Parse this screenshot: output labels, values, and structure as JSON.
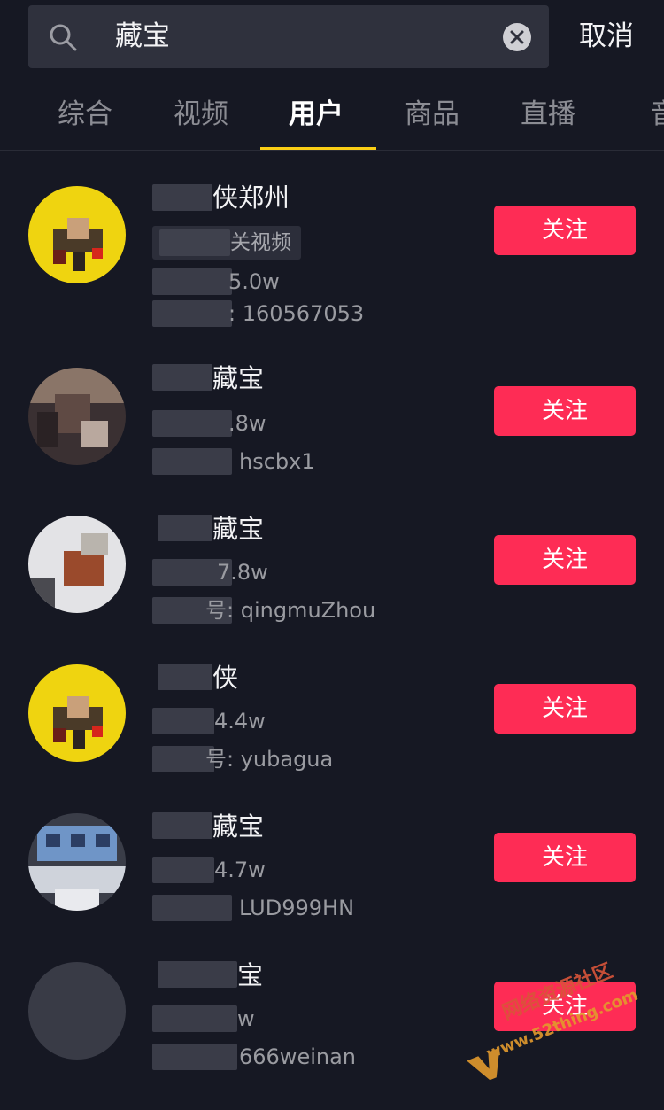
{
  "search": {
    "query": "藏宝",
    "cancel_label": "取消"
  },
  "tabs": [
    {
      "label": "综合"
    },
    {
      "label": "视频"
    },
    {
      "label": "用户",
      "active": true
    },
    {
      "label": "商品"
    },
    {
      "label": "直播"
    },
    {
      "label": "音"
    }
  ],
  "users": [
    {
      "name_suffix": "侠郑州",
      "tag_suffix": "关视频",
      "followers_suffix": "5.0w",
      "id_suffix": ": 160567053",
      "follow_label": "关注",
      "avatar": "yellow-cartoon"
    },
    {
      "name_suffix": "藏宝",
      "followers_suffix": ".8w",
      "id_suffix": "hscbx1",
      "follow_label": "关注",
      "avatar": "photo-dark"
    },
    {
      "name_suffix": "藏宝",
      "followers_suffix": "7.8w",
      "id_suffix": "号: qingmuZhou",
      "follow_label": "关注",
      "avatar": "photo-light"
    },
    {
      "name_suffix": "侠",
      "followers_suffix": "4.4w",
      "id_suffix": "号: yubagua",
      "follow_label": "关注",
      "avatar": "yellow-cartoon"
    },
    {
      "name_suffix": "藏宝",
      "followers_suffix": "4.7w",
      "id_suffix": "LUD999HN",
      "follow_label": "关注",
      "avatar": "blue-pixel"
    },
    {
      "name_suffix": "宝",
      "followers_suffix": "w",
      "id_suffix": "666weinan",
      "follow_label": "关注",
      "avatar": "gray"
    }
  ],
  "watermark": {
    "text": "www.52thing.com",
    "brand": "网络资源社区"
  },
  "colors": {
    "background": "#161823",
    "accent": "#fe2c55",
    "tab_indicator": "#face15"
  }
}
